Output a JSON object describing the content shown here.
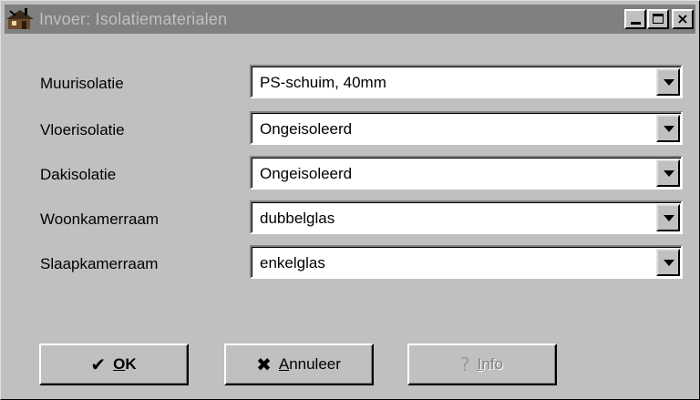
{
  "window": {
    "title": "Invoer: Isolatiematerialen",
    "app_icon": "house-icon",
    "controls": {
      "minimize": "minimize-icon",
      "maximize": "maximize-icon",
      "close": "×"
    }
  },
  "fields": [
    {
      "label": "Muurisolatie",
      "value": "PS-schuim, 40mm"
    },
    {
      "label": "Vloerisolatie",
      "value": "Ongeisoleerd"
    },
    {
      "label": "Dakisolatie",
      "value": "Ongeisoleerd"
    },
    {
      "label": "Woonkamerraam",
      "value": "dubbelglas"
    },
    {
      "label": "Slaapkamerraam",
      "value": "enkelglas"
    }
  ],
  "buttons": {
    "ok": {
      "accel": "O",
      "rest": "K",
      "icon": "checkmark-icon",
      "glyph": "✔"
    },
    "cancel": {
      "accel": "A",
      "rest": "nnuleer",
      "icon": "x-icon",
      "glyph": "✖"
    },
    "info": {
      "accel": "I",
      "rest": "nfo",
      "icon": "question-icon",
      "glyph": "?",
      "enabled": false
    }
  }
}
